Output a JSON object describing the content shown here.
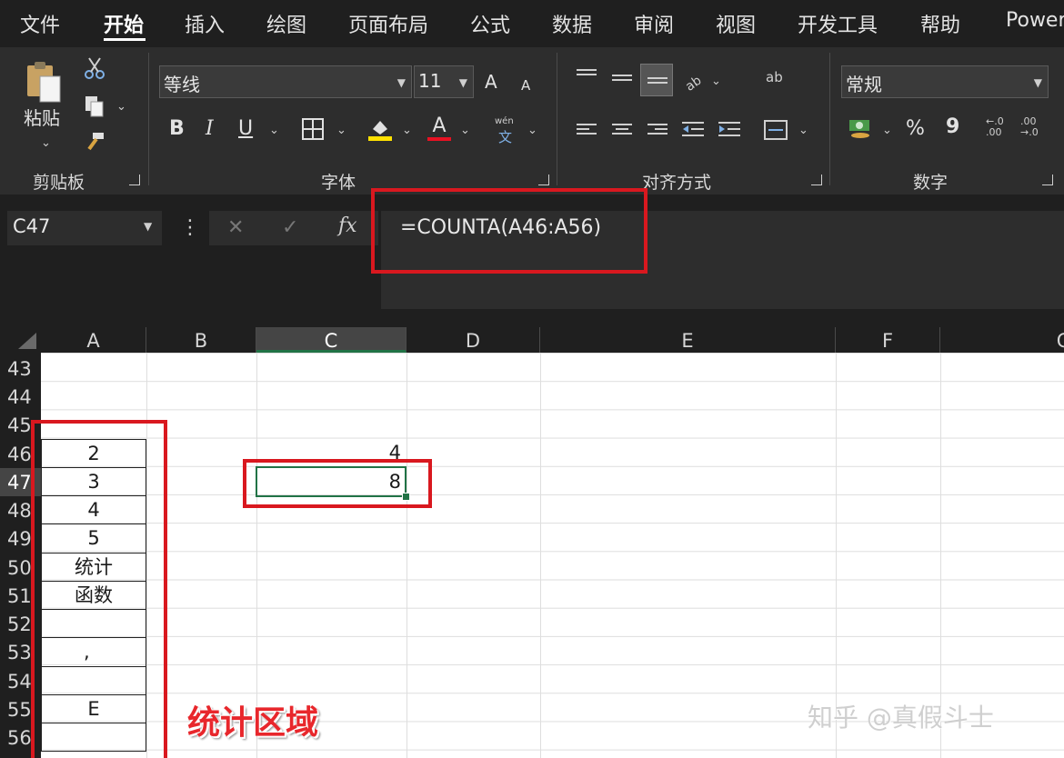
{
  "menu": {
    "tabs": [
      "文件",
      "开始",
      "插入",
      "绘图",
      "页面布局",
      "公式",
      "数据",
      "审阅",
      "视图",
      "开发工具",
      "帮助",
      "Power"
    ],
    "active": "开始"
  },
  "ribbon": {
    "clipboard": {
      "paste_label": "粘贴",
      "group_label": "剪贴板"
    },
    "font": {
      "font_name": "等线",
      "font_size": "11",
      "group_label": "字体",
      "bold": "B",
      "italic": "I",
      "underline": "U",
      "font_color_glyph": "A",
      "phonetic_top": "wén",
      "phonetic_bottom": "文",
      "grow_glyph": "A",
      "shrink_glyph": "A"
    },
    "alignment": {
      "group_label": "对齐方式",
      "wrap_glyph": "ab"
    },
    "number": {
      "format": "常规",
      "group_label": "数字",
      "percent": "%",
      "comma": "9",
      "inc_decimal": "←.0 .00",
      "dec_decimal": ".00 →.0"
    }
  },
  "formula_bar": {
    "name_box": "C47",
    "fx": "fx",
    "cancel": "✕",
    "enter": "✓",
    "more": "⋮",
    "formula": "=COUNTA(A46:A56)"
  },
  "grid": {
    "columns": [
      "A",
      "B",
      "C",
      "D",
      "E",
      "F",
      "G"
    ],
    "selected_column": "C",
    "rows": [
      "43",
      "44",
      "45",
      "46",
      "47",
      "48",
      "49",
      "50",
      "51",
      "52",
      "53",
      "54",
      "55",
      "56"
    ],
    "selected_row": "47",
    "a_cells": [
      "2",
      "3",
      "4",
      "5",
      "统计",
      "函数",
      "",
      ",",
      "",
      "E",
      ""
    ],
    "c46": "4",
    "c47": "8"
  },
  "annotations": {
    "region_label": "统计区域",
    "watermark": "知乎 @真假斗士",
    "highlight_color": "#d9181f"
  }
}
